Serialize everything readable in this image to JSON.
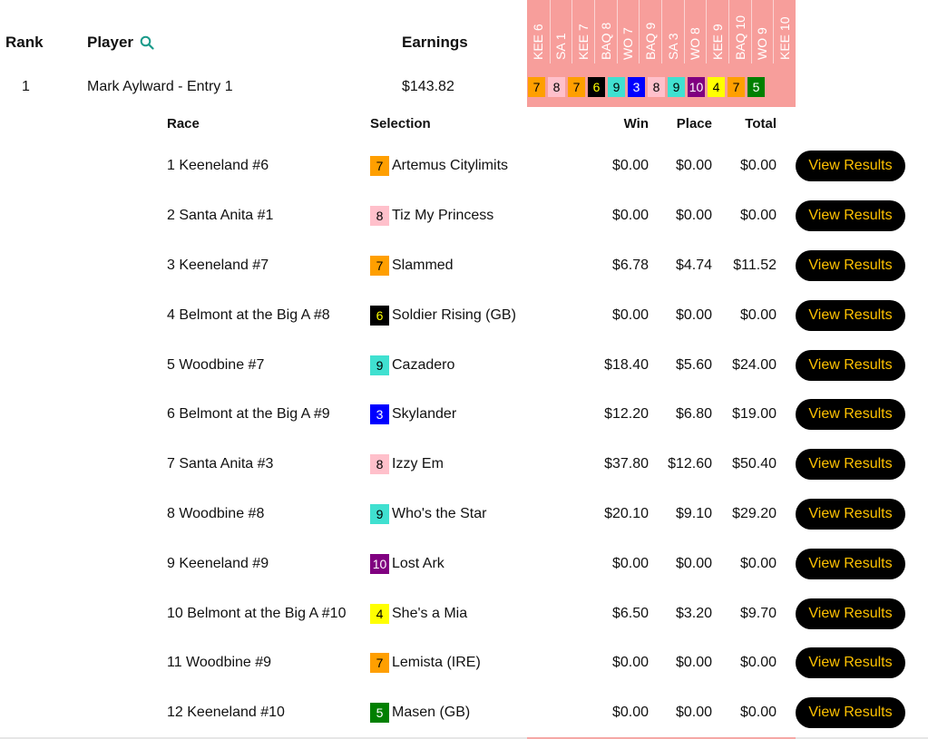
{
  "header": {
    "rank": "Rank",
    "player": "Player",
    "earnings": "Earnings"
  },
  "race_columns": [
    "KEE 6",
    "SA 1",
    "KEE 7",
    "BAQ 8",
    "WO 7",
    "BAQ 9",
    "SA 3",
    "WO 8",
    "KEE 9",
    "BAQ 10",
    "WO 9",
    "KEE 10"
  ],
  "entry": {
    "rank": "1",
    "player": "Mark Aylward - Entry 1",
    "earnings": "$143.82",
    "picks": [
      {
        "num": "7",
        "bg": "#ff9f00",
        "fg": "#000000"
      },
      {
        "num": "8",
        "bg": "#ffc0cb",
        "fg": "#000000"
      },
      {
        "num": "7",
        "bg": "#ff9f00",
        "fg": "#000000"
      },
      {
        "num": "6",
        "bg": "#000000",
        "fg": "#ffff00"
      },
      {
        "num": "9",
        "bg": "#40e0d0",
        "fg": "#000000"
      },
      {
        "num": "3",
        "bg": "#0000ff",
        "fg": "#ffffff"
      },
      {
        "num": "8",
        "bg": "#ffc0cb",
        "fg": "#000000"
      },
      {
        "num": "9",
        "bg": "#40e0d0",
        "fg": "#000000"
      },
      {
        "num": "10",
        "bg": "#800080",
        "fg": "#ffffff"
      },
      {
        "num": "4",
        "bg": "#ffff00",
        "fg": "#000000"
      },
      {
        "num": "7",
        "bg": "#ff9f00",
        "fg": "#000000"
      },
      {
        "num": "5",
        "bg": "#008000",
        "fg": "#ffffff"
      }
    ]
  },
  "detail_headers": {
    "race": "Race",
    "selection": "Selection",
    "win": "Win",
    "place": "Place",
    "total": "Total"
  },
  "button_label": "View Results",
  "colors": {
    "band": "#f79e9b",
    "button_bg": "#000000",
    "button_text": "#ffc200",
    "search_icon": "#1a9a8a"
  },
  "rows": [
    {
      "race": "1 Keeneland #6",
      "num": "7",
      "num_bg": "#ff9f00",
      "num_fg": "#000000",
      "horse": "Artemus Citylimits",
      "win": "$0.00",
      "place": "$0.00",
      "total": "$0.00"
    },
    {
      "race": "2 Santa Anita #1",
      "num": "8",
      "num_bg": "#ffc0cb",
      "num_fg": "#000000",
      "horse": "Tiz My Princess",
      "win": "$0.00",
      "place": "$0.00",
      "total": "$0.00"
    },
    {
      "race": "3 Keeneland #7",
      "num": "7",
      "num_bg": "#ff9f00",
      "num_fg": "#000000",
      "horse": "Slammed",
      "win": "$6.78",
      "place": "$4.74",
      "total": "$11.52"
    },
    {
      "race": "4 Belmont at the Big A #8",
      "num": "6",
      "num_bg": "#000000",
      "num_fg": "#ffff00",
      "horse": "Soldier Rising (GB)",
      "win": "$0.00",
      "place": "$0.00",
      "total": "$0.00"
    },
    {
      "race": "5 Woodbine #7",
      "num": "9",
      "num_bg": "#40e0d0",
      "num_fg": "#000000",
      "horse": "Cazadero",
      "win": "$18.40",
      "place": "$5.60",
      "total": "$24.00"
    },
    {
      "race": "6 Belmont at the Big A #9",
      "num": "3",
      "num_bg": "#0000ff",
      "num_fg": "#ffffff",
      "horse": "Skylander",
      "win": "$12.20",
      "place": "$6.80",
      "total": "$19.00"
    },
    {
      "race": "7 Santa Anita #3",
      "num": "8",
      "num_bg": "#ffc0cb",
      "num_fg": "#000000",
      "horse": "Izzy Em",
      "win": "$37.80",
      "place": "$12.60",
      "total": "$50.40"
    },
    {
      "race": "8 Woodbine #8",
      "num": "9",
      "num_bg": "#40e0d0",
      "num_fg": "#000000",
      "horse": "Who's the Star",
      "win": "$20.10",
      "place": "$9.10",
      "total": "$29.20"
    },
    {
      "race": "9 Keeneland #9",
      "num": "10",
      "num_bg": "#800080",
      "num_fg": "#ffffff",
      "horse": "Lost Ark",
      "win": "$0.00",
      "place": "$0.00",
      "total": "$0.00"
    },
    {
      "race": "10 Belmont at the Big A #10",
      "num": "4",
      "num_bg": "#ffff00",
      "num_fg": "#000000",
      "horse": "She's a Mia",
      "win": "$6.50",
      "place": "$3.20",
      "total": "$9.70"
    },
    {
      "race": "11 Woodbine #9",
      "num": "7",
      "num_bg": "#ff9f00",
      "num_fg": "#000000",
      "horse": "Lemista (IRE)",
      "win": "$0.00",
      "place": "$0.00",
      "total": "$0.00"
    },
    {
      "race": "12 Keeneland #10",
      "num": "5",
      "num_bg": "#008000",
      "num_fg": "#ffffff",
      "horse": "Masen (GB)",
      "win": "$0.00",
      "place": "$0.00",
      "total": "$0.00"
    }
  ]
}
